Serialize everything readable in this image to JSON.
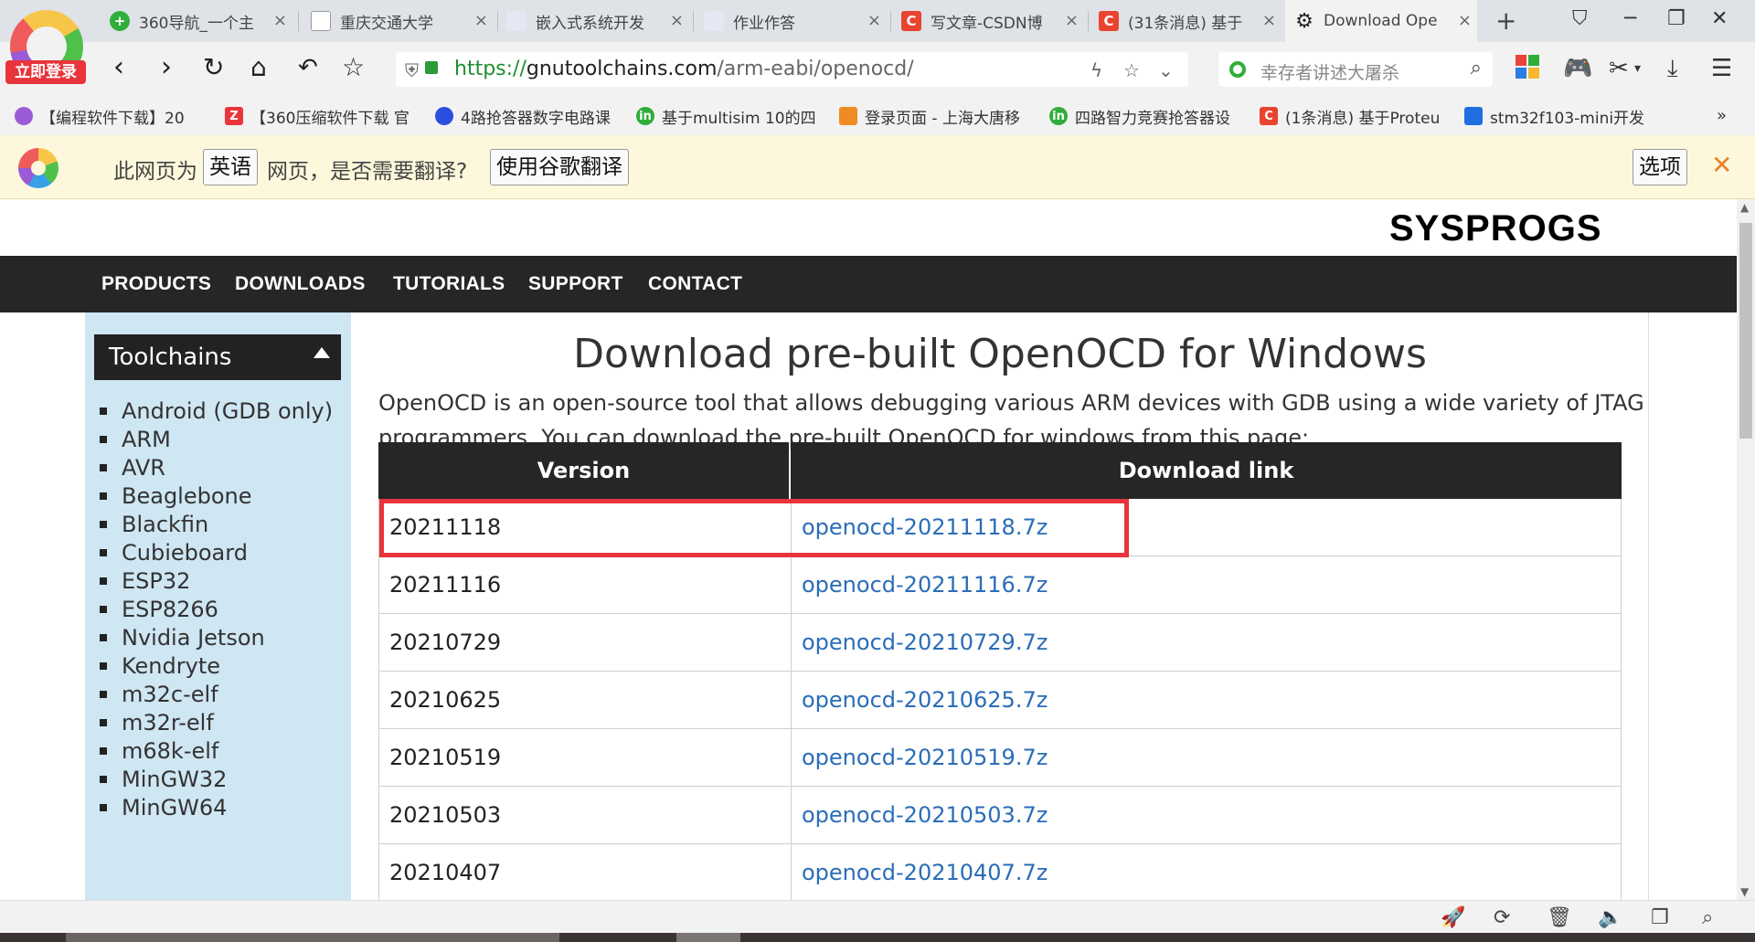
{
  "browser": {
    "login_badge": "立即登录",
    "tabs": [
      {
        "title": "360导航_一个主",
        "icon_color": "#2fae3b",
        "icon": "globe-icon"
      },
      {
        "title": "重庆交通大学",
        "icon_color": "#bbbbbb",
        "icon": "page-icon"
      },
      {
        "title": "嵌入式系统开发",
        "icon_color": "#e5e8f3",
        "icon": "page-icon"
      },
      {
        "title": "作业作答",
        "icon_color": "#e5e8f3",
        "icon": "page-icon"
      },
      {
        "title": "写文章-CSDN博",
        "icon_color": "#e8442f",
        "icon": "csdn-icon"
      },
      {
        "title": "(31条消息) 基于",
        "icon_color": "#e8442f",
        "icon": "csdn-icon"
      },
      {
        "title": "Download Ope",
        "icon_color": "#222222",
        "icon": "gear-icon"
      }
    ],
    "tab_close_glyph": "×",
    "new_tab_glyph": "+",
    "url": {
      "protocol": "https://",
      "host": "gnutoolchains.com",
      "path": "/arm-eabi/openocd/"
    },
    "search_placeholder": "幸存者讲述大屠杀",
    "bookmarks": [
      {
        "label": "【编程软件下载】20",
        "icon_color": "#9a5bd6"
      },
      {
        "label": "【360压缩软件下载 官",
        "icon_color": "#e8343a"
      },
      {
        "label": "4路抢答器数字电路课",
        "icon_color": "#2b50e0"
      },
      {
        "label": "基于multisim 10的四",
        "icon_color": "#2fae3b"
      },
      {
        "label": "登录页面 - 上海大唐移",
        "icon_color": "#f08a24"
      },
      {
        "label": "四路智力竞赛抢答器设",
        "icon_color": "#2fae3b"
      },
      {
        "label": "(1条消息) 基于Proteu",
        "icon_color": "#e8442f"
      },
      {
        "label": "stm32f103-mini开发",
        "icon_color": "#1f6fe0"
      }
    ],
    "bookmarks_more": "»",
    "translate": {
      "prefix": "此网页为",
      "language": "英语",
      "question": "网页，是否需要翻译?",
      "translate_button": "使用谷歌翻译",
      "options_button": "选项",
      "close_glyph": "✕"
    }
  },
  "site": {
    "brand": "SYSPROGS",
    "nav": [
      "PRODUCTS",
      "DOWNLOADS",
      "TUTORIALS",
      "SUPPORT",
      "CONTACT"
    ],
    "sidebar": {
      "title": "Toolchains",
      "items": [
        "Android (GDB only)",
        "ARM",
        "AVR",
        "Beaglebone",
        "Blackfin",
        "Cubieboard",
        "ESP32",
        "ESP8266",
        "Nvidia Jetson",
        "Kendryte",
        "m32c-elf",
        "m32r-elf",
        "m68k-elf",
        "MinGW32",
        "MinGW64"
      ]
    },
    "main": {
      "title": "Download pre-built OpenOCD for Windows",
      "intro": "OpenOCD is an open-source tool that allows debugging various ARM devices with GDB using a wide variety of JTAG programmers. You can download the pre-built OpenOCD for windows from this page:",
      "table": {
        "headers": [
          "Version",
          "Download link"
        ],
        "rows": [
          {
            "version": "20211118",
            "link": "openocd-20211118.7z"
          },
          {
            "version": "20211116",
            "link": "openocd-20211116.7z"
          },
          {
            "version": "20210729",
            "link": "openocd-20210729.7z"
          },
          {
            "version": "20210625",
            "link": "openocd-20210625.7z"
          },
          {
            "version": "20210519",
            "link": "openocd-20210519.7z"
          },
          {
            "version": "20210503",
            "link": "openocd-20210503.7z"
          },
          {
            "version": "20210407",
            "link": "openocd-20210407.7z"
          }
        ],
        "highlighted_row": 0,
        "highlight_color": "#e8343a"
      }
    }
  },
  "colors": {
    "nav_bg": "#262626",
    "sidebar_bg": "#cfe6f3",
    "link": "#2a6db8",
    "translate_bg": "#fdf8dc"
  }
}
